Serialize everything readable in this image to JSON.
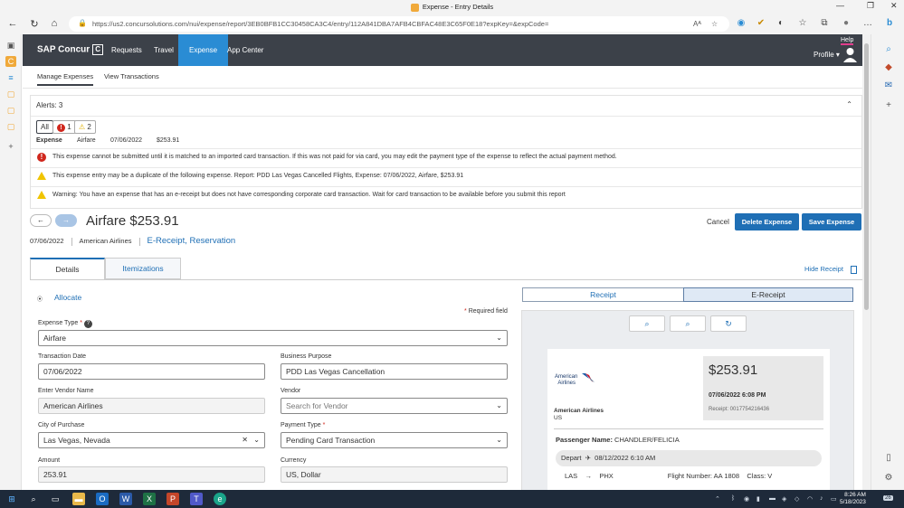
{
  "browser": {
    "window_title": "Expense - Entry Details",
    "url": "https://us2.concursolutions.com/nui/expense/report/3EB0BFB1CC30458CA3C4/entry/112A841DBA7AFB4CBFAC48E3C65F0E18?expKey=&expCode=",
    "reader_label": "Aᴬ"
  },
  "app": {
    "logo": "SAP Concur",
    "logo_mark": "C",
    "nav": [
      "Requests",
      "Travel",
      "Expense",
      "App Center"
    ],
    "active_nav": "Expense",
    "profile_label": "Profile",
    "help_label": "Help"
  },
  "subnav": [
    "Manage Expenses",
    "View Transactions"
  ],
  "alerts": {
    "header": "Alerts: 3",
    "filter_all": "All",
    "error_count": "1",
    "warning_count": "2",
    "summary": {
      "label": "Expense",
      "type": "Airfare",
      "date": "07/06/2022",
      "amount": "$253.91"
    },
    "messages": [
      {
        "level": "error",
        "text": "This expense cannot be submitted until it is matched to an imported card transaction. If this was not paid for via card, you may edit the payment type of the expense to reflect the actual payment method."
      },
      {
        "level": "warning",
        "text": "This expense entry may be a duplicate of the following expense. Report: PDD Las Vegas Cancelled Flights, Expense: 07/06/2022, Airfare, $253.91"
      },
      {
        "level": "warning",
        "text": "Warning: You have an expense that has an e-receipt but does not have corresponding corporate card transaction. Wait for card transaction to be available before you submit this report"
      }
    ]
  },
  "expense": {
    "title": "Airfare $253.91",
    "date": "07/06/2022",
    "vendor": "American Airlines",
    "receipt_links": "E-Receipt, Reservation",
    "cancel_label": "Cancel",
    "delete_label": "Delete Expense",
    "save_label": "Save Expense"
  },
  "tabs": [
    "Details",
    "Itemizations"
  ],
  "hide_receipt_label": "Hide Receipt",
  "form": {
    "allocate": "Allocate",
    "required_note": "Required field",
    "expense_type_label": "Expense Type",
    "expense_type": "Airfare",
    "transaction_date_label": "Transaction Date",
    "transaction_date": "07/06/2022",
    "business_purpose_label": "Business Purpose",
    "business_purpose": "PDD Las Vegas Cancellation",
    "vendor_name_label": "Enter Vendor Name",
    "vendor_name": "American Airlines",
    "vendor_label": "Vendor",
    "vendor_placeholder": "Search for Vendor",
    "city_label": "City of Purchase",
    "city": "Las Vegas, Nevada",
    "payment_type_label": "Payment Type",
    "payment_type": "Pending Card Transaction",
    "amount_label": "Amount",
    "amount": "253.91",
    "currency_label": "Currency",
    "currency": "US, Dollar"
  },
  "receipt": {
    "tabs": [
      "Receipt",
      "E-Receipt"
    ],
    "active_tab": "E-Receipt",
    "airline_logo_line1": "American",
    "airline_logo_line2": "Airlines",
    "amount": "$253.91",
    "datetime": "07/06/2022 6:08 PM",
    "receipt_no": "Receipt: 0017754216436",
    "airline_name": "American Airlines",
    "airline_country": "US",
    "passenger_label": "Passenger Name:",
    "passenger": "CHANDLER/FELICIA",
    "depart_label": "Depart",
    "depart_datetime": "08/12/2022 6:10 AM",
    "from": "LAS",
    "to": "PHX",
    "flight_label": "Flight Number:",
    "flight": "AA 1808",
    "class_label": "Class:",
    "class": "V"
  },
  "taskbar": {
    "time": "8:26 AM",
    "date": "5/18/2023",
    "notif": "26"
  }
}
